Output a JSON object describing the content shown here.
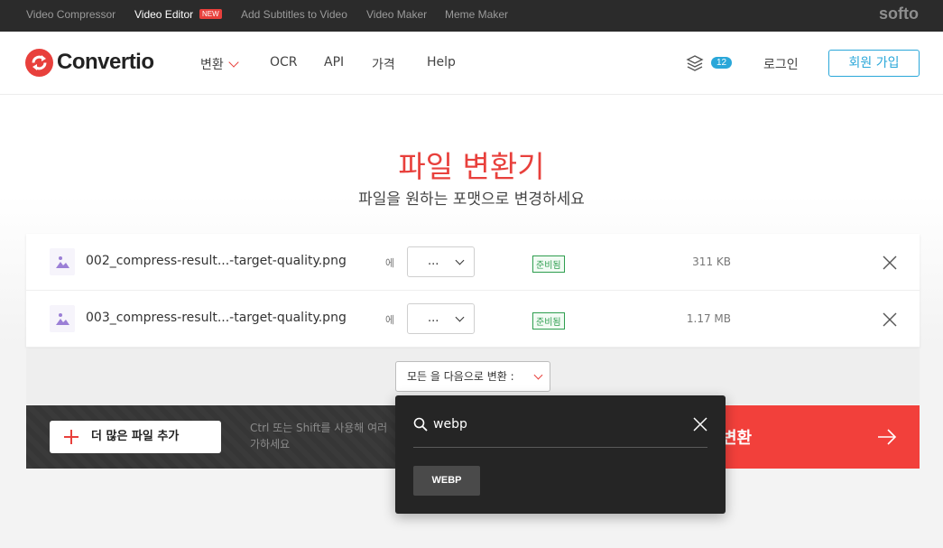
{
  "topbar": {
    "links": [
      "Video Compressor",
      "Video Editor",
      "Add Subtitles to Video",
      "Video Maker",
      "Meme Maker"
    ],
    "new_badge": "NEW",
    "brand": "softo"
  },
  "header": {
    "logo_text": "Convertio",
    "nav": [
      "변환",
      "OCR",
      "API",
      "가격",
      "Help"
    ],
    "queue_count": "12",
    "login": "로그인",
    "signup": "회원 가입"
  },
  "hero": {
    "title": "파일 변환기",
    "subtitle": "파일을 원하는 포맷으로 변경하세요"
  },
  "files": [
    {
      "name": "002_compress-result...-target-quality.png",
      "to": "에",
      "format": "...",
      "status": "준비됨",
      "size": "311 KB"
    },
    {
      "name": "003_compress-result...-target-quality.png",
      "to": "에",
      "format": "...",
      "status": "준비됨",
      "size": "1.17 MB"
    }
  ],
  "convert_all": {
    "label": "모든 을 다음으로 변환 :"
  },
  "actions": {
    "add_more": "더 많은 파일 추가",
    "hint": "Ctrl 또는 Shift를 사용해 여러 가하세요",
    "convert": "변환"
  },
  "dropdown": {
    "search_value": "webp",
    "options": [
      "WEBP"
    ]
  },
  "colors": {
    "accent": "#e8403c",
    "link_blue": "#2aa7d9",
    "status_green": "#2e9e4f"
  }
}
